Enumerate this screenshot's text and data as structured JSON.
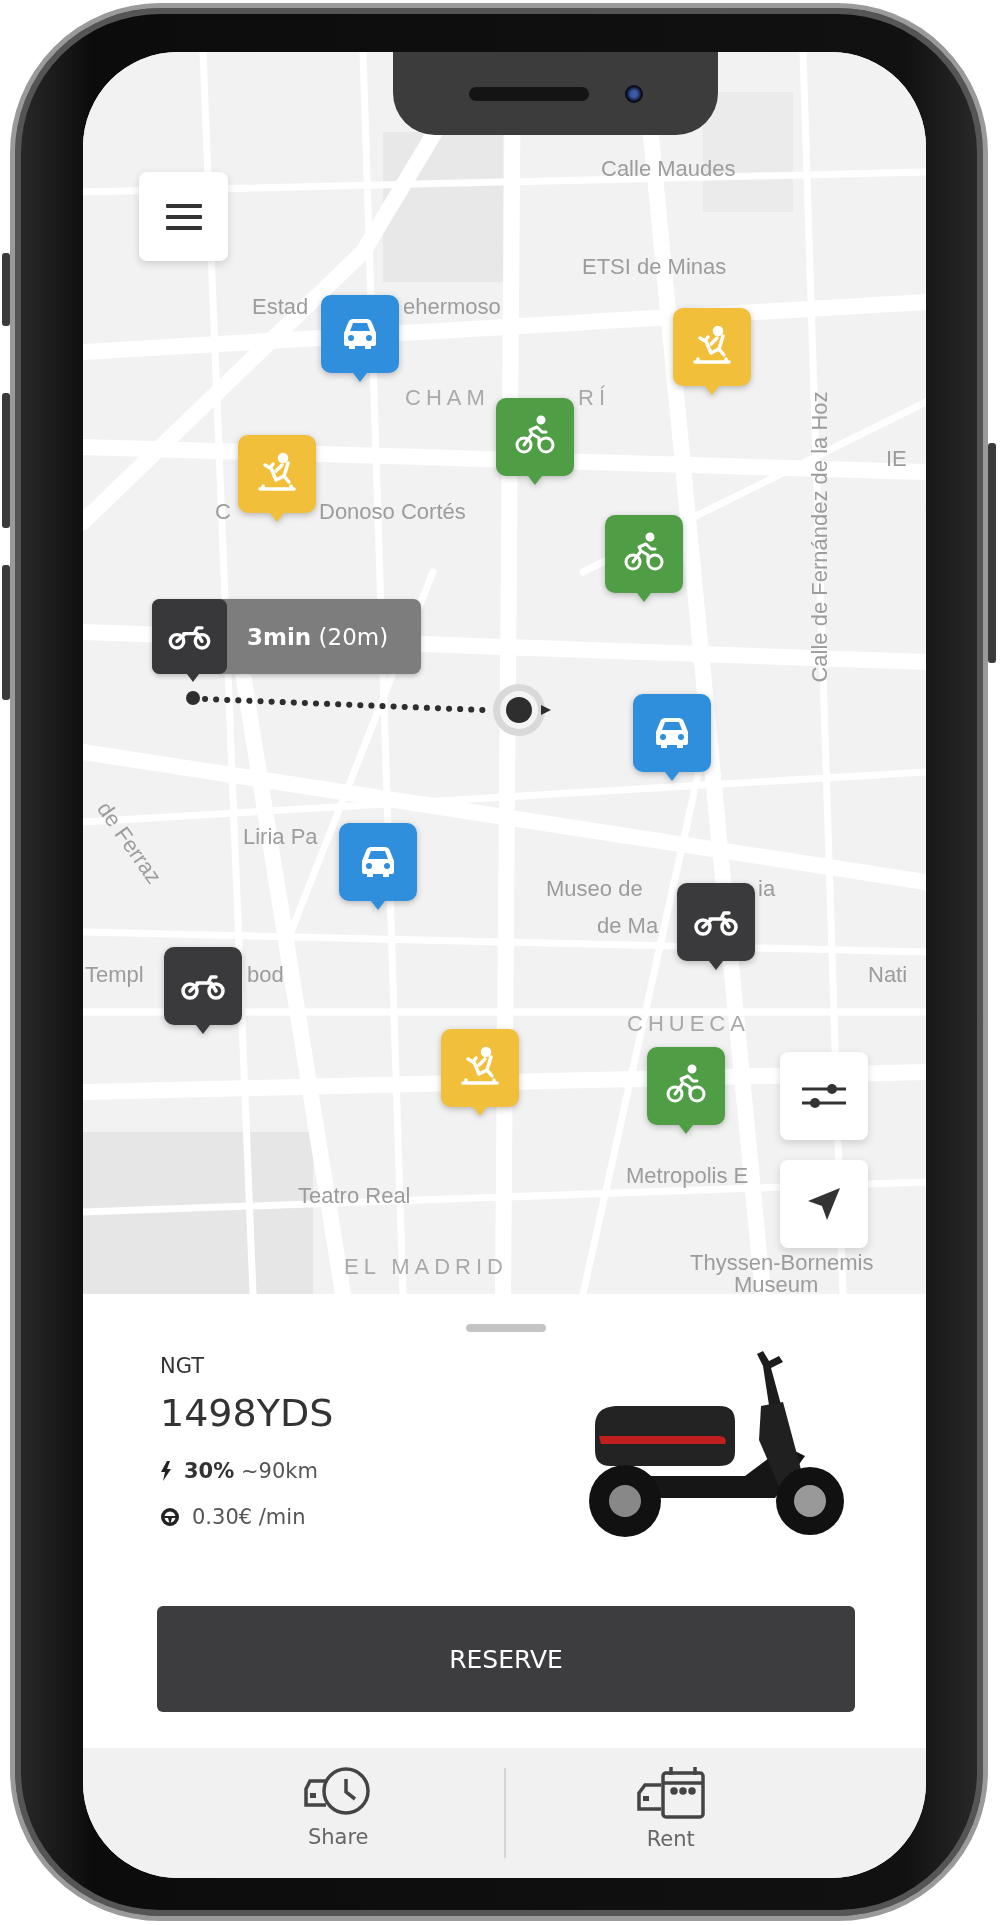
{
  "map": {
    "labels": [
      {
        "text": "Calle Maudes",
        "kind": "street"
      },
      {
        "text": "ETSI de Minas",
        "kind": "street"
      },
      {
        "text": "Estad",
        "kind": "street"
      },
      {
        "text": "ehermoso",
        "kind": "street"
      },
      {
        "text": "CHAM",
        "kind": "district"
      },
      {
        "text": "RÍ",
        "kind": "district"
      },
      {
        "text": "IE",
        "kind": "street"
      },
      {
        "text": "C",
        "kind": "street"
      },
      {
        "text": "Donoso Cortés",
        "kind": "street"
      },
      {
        "text": "Calle de Fernández de la Hoz",
        "kind": "vertical"
      },
      {
        "text": "de Ferraz",
        "kind": "diagonal"
      },
      {
        "text": "Liria Pa",
        "kind": "street"
      },
      {
        "text": "Museo de",
        "kind": "street"
      },
      {
        "text": "ia",
        "kind": "street"
      },
      {
        "text": "de Ma",
        "kind": "street"
      },
      {
        "text": "Templ",
        "kind": "street"
      },
      {
        "text": "bod",
        "kind": "street"
      },
      {
        "text": "Nati",
        "kind": "street"
      },
      {
        "text": "CHUECA",
        "kind": "district"
      },
      {
        "text": "Metropolis E",
        "kind": "street"
      },
      {
        "text": "Teatro Real",
        "kind": "street"
      },
      {
        "text": "EL MADRID",
        "kind": "district"
      },
      {
        "text": "Thyssen-Bornemis",
        "kind": "street"
      },
      {
        "text": "Museum",
        "kind": "street"
      }
    ],
    "markers": [
      {
        "kind": "car",
        "color": "#2f8fdd"
      },
      {
        "kind": "scooter",
        "color": "#f2bf3a"
      },
      {
        "kind": "bike",
        "color": "#4f9d45"
      },
      {
        "kind": "scooter",
        "color": "#f2bf3a"
      },
      {
        "kind": "bike",
        "color": "#4f9d45"
      },
      {
        "kind": "car",
        "color": "#2f8fdd"
      },
      {
        "kind": "car",
        "color": "#2f8fdd"
      },
      {
        "kind": "motorbike",
        "color": "#3a3a3d"
      },
      {
        "kind": "motorbike",
        "color": "#3a3a3d"
      },
      {
        "kind": "scooter",
        "color": "#f2bf3a"
      },
      {
        "kind": "bike",
        "color": "#4f9d45"
      }
    ],
    "route": {
      "eta": "**3min** (20m)"
    }
  },
  "vehicle": {
    "brand": "NGT",
    "plate": "1498YDS",
    "battery": "**30%** ~90km",
    "price": "0.30€ /min"
  },
  "reserve_button": "RESERVE",
  "nav": [
    {
      "label": "Share",
      "kind": "share"
    },
    {
      "label": "Rent",
      "kind": "rent"
    }
  ]
}
